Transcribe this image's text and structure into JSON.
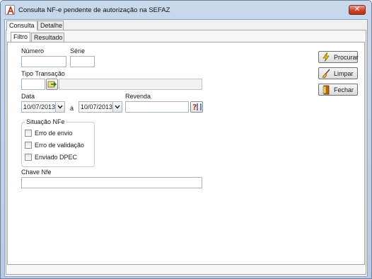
{
  "window": {
    "title": "Consulta NF-e pendente de autorização na SEFAZ",
    "close_glyph": "✕"
  },
  "top_tabs": [
    {
      "label": "Consulta",
      "active": true
    },
    {
      "label": "Detalhe",
      "active": false
    }
  ],
  "sub_tabs": [
    {
      "label": "Filtro",
      "active": true
    },
    {
      "label": "Resultado",
      "active": false
    }
  ],
  "form": {
    "numero": {
      "label": "Número",
      "value": ""
    },
    "serie": {
      "label": "Série",
      "value": ""
    },
    "tipo_transacao": {
      "label": "Tipo Transação",
      "code": "",
      "description": ""
    },
    "data": {
      "label": "Data",
      "from": "10/07/2013",
      "separator": "à",
      "to": "10/07/2013"
    },
    "revenda": {
      "label": "Revenda",
      "value": ""
    },
    "situacao": {
      "label": "Situação NFe",
      "options": [
        {
          "label": "Erro de envio",
          "checked": false
        },
        {
          "label": "Erro de validação",
          "checked": false
        },
        {
          "label": "Enviado DPEC",
          "checked": false
        }
      ]
    },
    "chave": {
      "label": "Chave Nfe",
      "value": ""
    }
  },
  "actions": {
    "procurar": "Procurar",
    "limpar": "Limpar",
    "fechar": "Fechar"
  },
  "icons": {
    "app": "app-logo-icon",
    "lookup": "lookup-arrow-icon",
    "revenda_search": "search-question-icon",
    "procurar": "lightning-icon",
    "limpar": "broom-icon",
    "fechar": "door-icon"
  },
  "colors": {
    "close_button": "#c9452a",
    "titlebar": "#c9d9ec"
  }
}
